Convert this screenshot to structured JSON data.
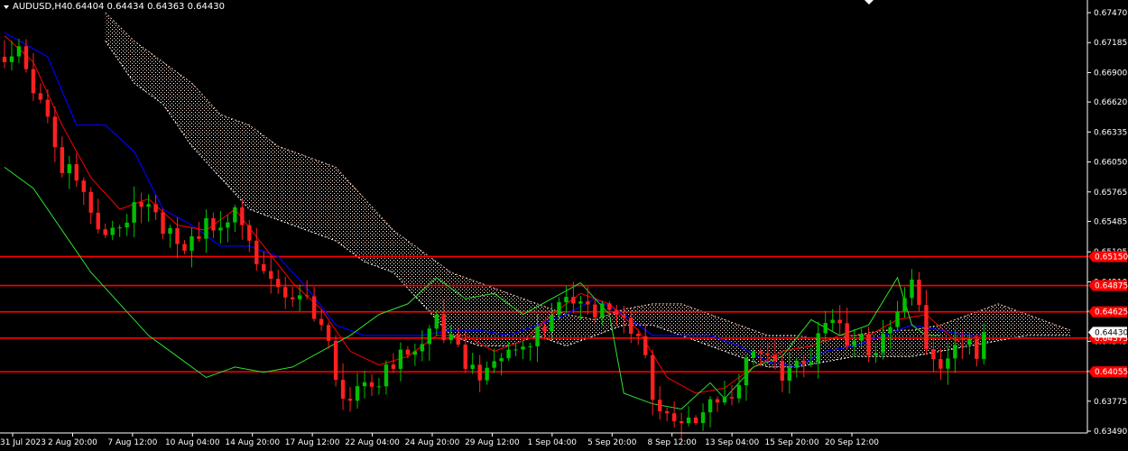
{
  "header": {
    "symbol_timeframe": "AUDUSD,H4",
    "ohlc": "0.64404 0.64434 0.64363 0.64430"
  },
  "colors": {
    "background": "#000000",
    "axis": "#ffffff",
    "bull_candle": "#00c000",
    "bear_candle": "#ff2020",
    "tenkan": "#ff0000",
    "kijun": "#0000ff",
    "chikou": "#30e030",
    "cloud_a": "#f5c8b0",
    "cloud_b": "#ffffff",
    "level_line": "#ff0000",
    "price_tag": "#ffffff"
  },
  "chart_data": {
    "type": "candlestick",
    "title": "AUDUSD,H4",
    "ylim": [
      0.6349,
      0.6747
    ],
    "y_ticks": [
      "0.67470",
      "0.67185",
      "0.66900",
      "0.66620",
      "0.66335",
      "0.66050",
      "0.65765",
      "0.65485",
      "0.65195",
      "0.64910",
      "0.64630",
      "0.64345",
      "0.64060",
      "0.63775",
      "0.63490"
    ],
    "x_labels": [
      "31 Jul 2023",
      "2 Aug 20:00",
      "7 Aug 12:00",
      "10 Aug 04:00",
      "14 Aug 20:00",
      "17 Aug 12:00",
      "22 Aug 04:00",
      "24 Aug 20:00",
      "29 Aug 12:00",
      "1 Sep 04:00",
      "5 Sep 20:00",
      "8 Sep 12:00",
      "13 Sep 04:00",
      "15 Sep 20:00",
      "20 Sep 12:00"
    ],
    "horizontal_levels": [
      {
        "value": 0.6515,
        "label": "0.65150"
      },
      {
        "value": 0.64875,
        "label": "0.64875"
      },
      {
        "value": 0.64625,
        "label": "0.64625"
      },
      {
        "value": 0.64375,
        "label": "0.64375"
      },
      {
        "value": 0.64055,
        "label": "0.64055"
      }
    ],
    "current_price": {
      "value": 0.6443,
      "label": "0.64430"
    },
    "price_path": [
      [
        0,
        0.6705
      ],
      [
        2,
        0.673
      ],
      [
        4,
        0.669
      ],
      [
        6,
        0.666
      ],
      [
        8,
        0.661
      ],
      [
        10,
        0.6595
      ],
      [
        12,
        0.6555
      ],
      [
        14,
        0.653
      ],
      [
        16,
        0.656
      ],
      [
        18,
        0.6575
      ],
      [
        20,
        0.6575
      ],
      [
        22,
        0.656
      ],
      [
        24,
        0.652
      ],
      [
        26,
        0.653
      ],
      [
        28,
        0.6545
      ],
      [
        30,
        0.6545
      ],
      [
        32,
        0.658
      ],
      [
        34,
        0.6545
      ],
      [
        36,
        0.6515
      ],
      [
        38,
        0.649
      ],
      [
        40,
        0.647
      ],
      [
        42,
        0.6475
      ],
      [
        44,
        0.645
      ],
      [
        46,
        0.641
      ],
      [
        48,
        0.6395
      ],
      [
        50,
        0.6405
      ],
      [
        52,
        0.641
      ],
      [
        54,
        0.6415
      ],
      [
        56,
        0.6425
      ],
      [
        58,
        0.643
      ],
      [
        60,
        0.646
      ],
      [
        62,
        0.645
      ],
      [
        64,
        0.643
      ],
      [
        66,
        0.642
      ],
      [
        68,
        0.6415
      ],
      [
        70,
        0.6425
      ],
      [
        72,
        0.643
      ],
      [
        74,
        0.6445
      ],
      [
        76,
        0.648
      ],
      [
        78,
        0.6485
      ],
      [
        80,
        0.6495
      ],
      [
        82,
        0.6475
      ],
      [
        84,
        0.646
      ],
      [
        86,
        0.6455
      ],
      [
        88,
        0.644
      ],
      [
        90,
        0.64
      ],
      [
        92,
        0.6375
      ],
      [
        94,
        0.637
      ],
      [
        96,
        0.6375
      ],
      [
        98,
        0.638
      ],
      [
        100,
        0.638
      ],
      [
        102,
        0.6395
      ],
      [
        104,
        0.643
      ],
      [
        106,
        0.6435
      ],
      [
        108,
        0.642
      ],
      [
        110,
        0.6425
      ],
      [
        112,
        0.643
      ],
      [
        114,
        0.645
      ],
      [
        116,
        0.6445
      ],
      [
        118,
        0.643
      ],
      [
        120,
        0.644
      ],
      [
        122,
        0.645
      ],
      [
        124,
        0.6475
      ],
      [
        126,
        0.6505
      ],
      [
        128,
        0.643
      ],
      [
        130,
        0.6415
      ],
      [
        132,
        0.6425
      ],
      [
        134,
        0.644
      ],
      [
        136,
        0.6443
      ]
    ],
    "tenkan_path": [
      [
        0,
        0.6725
      ],
      [
        4,
        0.67
      ],
      [
        8,
        0.664
      ],
      [
        12,
        0.659
      ],
      [
        16,
        0.656
      ],
      [
        20,
        0.657
      ],
      [
        24,
        0.6545
      ],
      [
        28,
        0.654
      ],
      [
        32,
        0.656
      ],
      [
        36,
        0.6525
      ],
      [
        40,
        0.649
      ],
      [
        44,
        0.6465
      ],
      [
        48,
        0.6425
      ],
      [
        52,
        0.6412
      ],
      [
        56,
        0.642
      ],
      [
        60,
        0.644
      ],
      [
        64,
        0.644
      ],
      [
        68,
        0.6425
      ],
      [
        72,
        0.6435
      ],
      [
        76,
        0.646
      ],
      [
        80,
        0.648
      ],
      [
        84,
        0.647
      ],
      [
        88,
        0.6445
      ],
      [
        92,
        0.64
      ],
      [
        96,
        0.6385
      ],
      [
        100,
        0.639
      ],
      [
        104,
        0.641
      ],
      [
        108,
        0.6425
      ],
      [
        112,
        0.643
      ],
      [
        116,
        0.644
      ],
      [
        120,
        0.644
      ],
      [
        124,
        0.6455
      ],
      [
        128,
        0.646
      ],
      [
        132,
        0.6435
      ],
      [
        136,
        0.644
      ]
    ],
    "kijun_path": [
      [
        0,
        0.6728
      ],
      [
        6,
        0.6705
      ],
      [
        10,
        0.664
      ],
      [
        14,
        0.664
      ],
      [
        18,
        0.6615
      ],
      [
        22,
        0.656
      ],
      [
        26,
        0.6545
      ],
      [
        30,
        0.6525
      ],
      [
        34,
        0.6525
      ],
      [
        38,
        0.6515
      ],
      [
        42,
        0.6485
      ],
      [
        46,
        0.645
      ],
      [
        50,
        0.644
      ],
      [
        54,
        0.644
      ],
      [
        58,
        0.644
      ],
      [
        62,
        0.6445
      ],
      [
        66,
        0.6445
      ],
      [
        70,
        0.644
      ],
      [
        74,
        0.645
      ],
      [
        78,
        0.646
      ],
      [
        82,
        0.6475
      ],
      [
        86,
        0.646
      ],
      [
        90,
        0.644
      ],
      [
        94,
        0.644
      ],
      [
        98,
        0.644
      ],
      [
        102,
        0.643
      ],
      [
        106,
        0.6415
      ],
      [
        110,
        0.641
      ],
      [
        114,
        0.6425
      ],
      [
        118,
        0.643
      ],
      [
        122,
        0.644
      ],
      [
        126,
        0.645
      ],
      [
        130,
        0.6445
      ],
      [
        134,
        0.644
      ],
      [
        136,
        0.644
      ]
    ],
    "chikou_path": [
      [
        0,
        0.66
      ],
      [
        4,
        0.658
      ],
      [
        8,
        0.654
      ],
      [
        12,
        0.65
      ],
      [
        16,
        0.647
      ],
      [
        20,
        0.644
      ],
      [
        24,
        0.642
      ],
      [
        28,
        0.64
      ],
      [
        32,
        0.641
      ],
      [
        36,
        0.6405
      ],
      [
        40,
        0.641
      ],
      [
        44,
        0.6425
      ],
      [
        48,
        0.644
      ],
      [
        52,
        0.646
      ],
      [
        56,
        0.647
      ],
      [
        60,
        0.6495
      ],
      [
        64,
        0.6475
      ],
      [
        68,
        0.648
      ],
      [
        72,
        0.646
      ],
      [
        76,
        0.6475
      ],
      [
        80,
        0.649
      ],
      [
        84,
        0.646
      ],
      [
        86,
        0.6385
      ],
      [
        90,
        0.6375
      ],
      [
        94,
        0.637
      ],
      [
        98,
        0.6395
      ],
      [
        100,
        0.638
      ],
      [
        104,
        0.641
      ],
      [
        108,
        0.642
      ],
      [
        112,
        0.6455
      ],
      [
        116,
        0.644
      ],
      [
        120,
        0.645
      ],
      [
        124,
        0.6495
      ],
      [
        126,
        0.645
      ],
      [
        128,
        0.644
      ],
      [
        130,
        0.644
      ]
    ],
    "cloud": [
      [
        14,
        0.6747,
        0.672
      ],
      [
        18,
        0.672,
        0.668
      ],
      [
        22,
        0.67,
        0.666
      ],
      [
        26,
        0.668,
        0.662
      ],
      [
        30,
        0.665,
        0.659
      ],
      [
        34,
        0.664,
        0.656
      ],
      [
        38,
        0.662,
        0.655
      ],
      [
        42,
        0.661,
        0.654
      ],
      [
        46,
        0.66,
        0.653
      ],
      [
        50,
        0.657,
        0.651
      ],
      [
        54,
        0.654,
        0.65
      ],
      [
        58,
        0.652,
        0.647
      ],
      [
        62,
        0.65,
        0.644
      ],
      [
        66,
        0.649,
        0.643
      ],
      [
        70,
        0.648,
        0.643
      ],
      [
        74,
        0.647,
        0.644
      ],
      [
        78,
        0.646,
        0.643
      ],
      [
        82,
        0.6455,
        0.644
      ],
      [
        86,
        0.6465,
        0.645
      ],
      [
        90,
        0.647,
        0.645
      ],
      [
        94,
        0.647,
        0.644
      ],
      [
        98,
        0.646,
        0.643
      ],
      [
        102,
        0.645,
        0.642
      ],
      [
        106,
        0.644,
        0.641
      ],
      [
        110,
        0.644,
        0.641
      ],
      [
        114,
        0.6435,
        0.6415
      ],
      [
        118,
        0.644,
        0.642
      ],
      [
        122,
        0.6445,
        0.642
      ],
      [
        126,
        0.6445,
        0.642
      ],
      [
        130,
        0.645,
        0.6425
      ],
      [
        134,
        0.646,
        0.643
      ],
      [
        138,
        0.647,
        0.6435
      ],
      [
        142,
        0.646,
        0.644
      ],
      [
        146,
        0.645,
        0.644
      ],
      [
        148,
        0.6445,
        0.644
      ]
    ]
  }
}
